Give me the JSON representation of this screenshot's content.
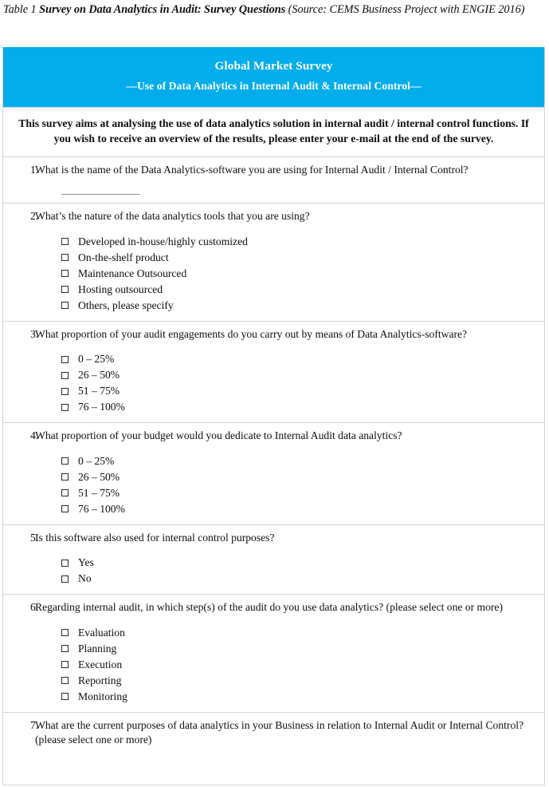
{
  "caption": {
    "label": "Table 1 ",
    "title": "Survey on Data Analytics in Audit: Survey Questions",
    "source": " (Source: CEMS Business Project with ENGIE 2016)"
  },
  "colors": {
    "header_blue": "#03ADEB",
    "header_text": "#ffffff",
    "border": "#d4d4d4",
    "body_text": "#0d0d0d"
  },
  "survey": {
    "header": {
      "title": "Global Market Survey",
      "subtitle": "—Use of Data Analytics in Internal Audit & Internal Control—"
    },
    "intro": "This survey aims at analysing the use of data analytics solution in internal audit / internal control functions. If you wish to receive an overview of the results, please enter your e-mail at the end of the survey.",
    "questions": [
      {
        "number": "1.",
        "text": "What is the name of the Data Analytics-software you are using for Internal Audit / Internal Control?",
        "answer_blank": true,
        "options": []
      },
      {
        "number": "2.",
        "text": "What’s the nature of the data analytics tools that you are using?",
        "answer_blank": false,
        "options": [
          "Developed in-house/highly customized",
          "On-the-shelf product",
          "Maintenance Outsourced",
          "Hosting outsourced",
          "Others, please specify"
        ]
      },
      {
        "number": "3.",
        "text": "What proportion of your audit engagements do you carry out by means of Data Analytics-software?",
        "answer_blank": false,
        "options": [
          "0 – 25%",
          "26 – 50%",
          "51 – 75%",
          "76 – 100%"
        ]
      },
      {
        "number": "4.",
        "text": "What proportion of your budget would you dedicate to Internal Audit data analytics?",
        "answer_blank": false,
        "options": [
          "0 – 25%",
          "26 – 50%",
          "51 – 75%",
          "76 – 100%"
        ]
      },
      {
        "number": "5.",
        "text": "Is this software also used for internal control purposes?",
        "answer_blank": false,
        "options": [
          "Yes",
          "No"
        ]
      },
      {
        "number": "6.",
        "text": "Regarding internal audit, in which step(s) of the audit do you use data analytics? (please select one or more)",
        "answer_blank": false,
        "options": [
          "Evaluation",
          "Planning",
          "Execution",
          "Reporting",
          "Monitoring"
        ]
      },
      {
        "number": "7.",
        "text": "What are the current purposes of data analytics in your Business in relation to Internal Audit or Internal Control? (please select one or more)",
        "answer_blank": false,
        "options": []
      }
    ]
  }
}
